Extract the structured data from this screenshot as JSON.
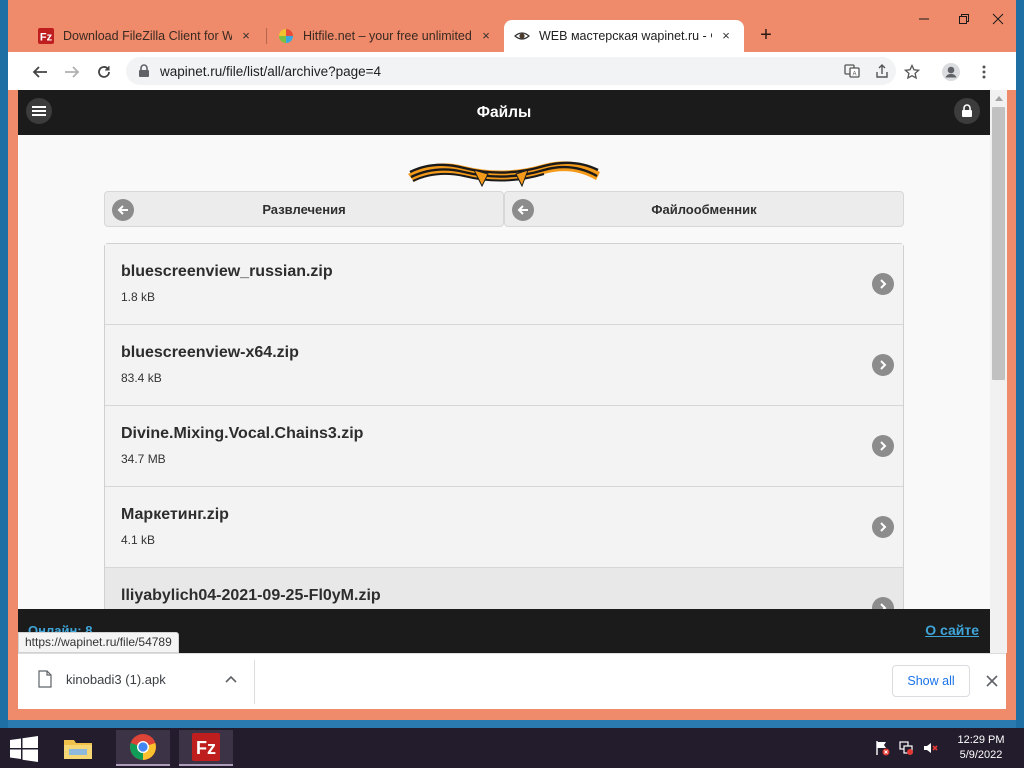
{
  "browser": {
    "tabs": [
      {
        "title": "Download FileZilla Client for Win",
        "icon": "filezilla-icon",
        "active": false
      },
      {
        "title": "Hitfile.net – your free unlimited f",
        "icon": "hitfile-icon",
        "active": false
      },
      {
        "title": "WEB мастерская wapinet.ru - Фа",
        "icon": "wapinet-eye-icon",
        "active": true
      }
    ],
    "new_tab_label": "+",
    "close_tab_glyph": "×",
    "url": "wapinet.ru/file/list/all/archive?page=4",
    "status_url": "https://wapinet.ru/file/54789"
  },
  "site": {
    "header_title": "Файлы",
    "nav": [
      {
        "label": "Развлечения"
      },
      {
        "label": "Файлообменник"
      }
    ],
    "files": [
      {
        "name": "bluescreenview_russian.zip",
        "size": "1.8 kB"
      },
      {
        "name": "bluescreenview-x64.zip",
        "size": "83.4 kB"
      },
      {
        "name": "Divine.Mixing.Vocal.Chains3.zip",
        "size": "34.7 MB"
      },
      {
        "name": "Маркетинг.zip",
        "size": "4.1 kB"
      },
      {
        "name": "lliyabylich04-2021-09-25-Fl0yM.zip",
        "size": ""
      }
    ],
    "footer_online": "Онлайн: 8",
    "footer_about": "О сайте",
    "accent_color": "#3fa5d9"
  },
  "downloads": {
    "file_name": "kinobadi3 (1).apk",
    "show_all_label": "Show all"
  },
  "taskbar": {
    "time": "12:29 PM",
    "date": "5/9/2022"
  }
}
